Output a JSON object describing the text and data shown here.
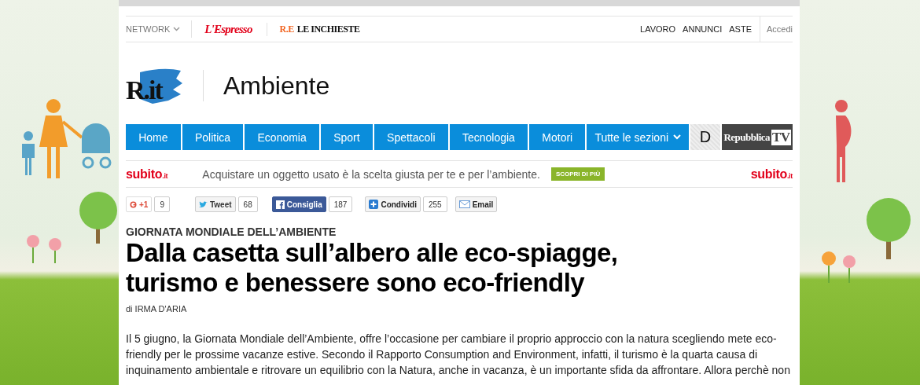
{
  "network_bar": {
    "menu": "NETWORK",
    "brands": [
      {
        "kind": "espresso",
        "label": "L'Espresso"
      },
      {
        "kind": "inchieste",
        "mark": "R.E",
        "label": "LE INCHIESTE"
      }
    ],
    "links": [
      "LAVORO",
      "ANNUNCI",
      "ASTE"
    ],
    "login": "Accedi"
  },
  "header": {
    "logo": "R.it",
    "section": "Ambiente"
  },
  "nav": {
    "items": [
      {
        "label": "Home",
        "kind": "link"
      },
      {
        "label": "Politica",
        "kind": "link"
      },
      {
        "label": "Economia",
        "kind": "link"
      },
      {
        "label": "Sport",
        "kind": "link"
      },
      {
        "label": "Spettacoli",
        "kind": "link"
      },
      {
        "label": "Tecnologia",
        "kind": "link"
      },
      {
        "label": "Motori",
        "kind": "link"
      },
      {
        "label": "Tutte le sezioni",
        "kind": "dropdown"
      }
    ],
    "d_button": "D",
    "tv": {
      "name": "Repubblica",
      "suffix": "TV"
    }
  },
  "ad": {
    "brand_left": {
      "name": "subito",
      "suffix": ".it"
    },
    "text": "Acquistare un oggetto usato è la scelta giusta per te e per l’ambiente.",
    "button": "SCOPRI DI PIÙ",
    "brand_right": {
      "name": "subito",
      "suffix": ".it"
    }
  },
  "share": [
    {
      "kind": "gplus",
      "label": "+1",
      "count": "9"
    },
    {
      "kind": "twitter",
      "label": "Tweet",
      "count": "68"
    },
    {
      "kind": "facebook",
      "label": "Consiglia",
      "count": "187"
    },
    {
      "kind": "share",
      "label": "Condividi",
      "count": "255"
    },
    {
      "kind": "email",
      "label": "Email"
    }
  ],
  "article": {
    "kicker": "GIORNATA MONDIALE DELL’AMBIENTE",
    "title_lines": [
      "Dalla casetta sull’albero alle eco-spiagge,",
      "turismo e benessere sono eco-friendly"
    ],
    "byline": "di IRMA D'ARIA",
    "paragraph": "Il 5 giugno, la Giornata Mondiale dell’Ambiente, offre l’occasione per cambiare il proprio approccio con la natura scegliendo mete eco-friendly per le prossime vacanze estive. Secondo il Rapporto Consumption and Environment, infatti, il turismo è la quarta causa di inquinamento ambientale e ritrovare un equilibrio con la Natura, anche in vacanza, è un importante sfida da affrontare. Allora perchè non"
  }
}
